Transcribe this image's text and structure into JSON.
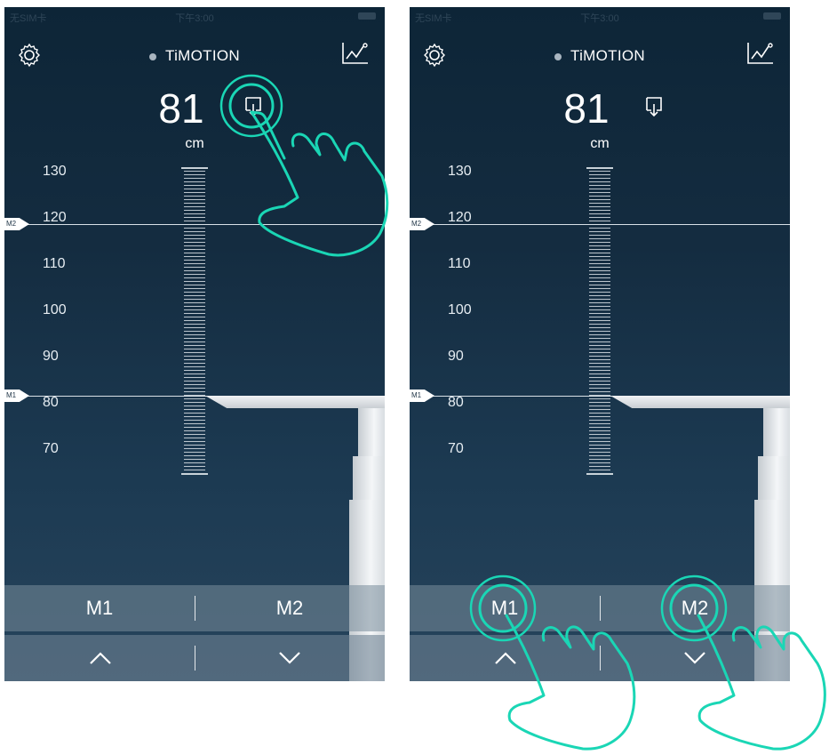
{
  "status": {
    "carrier": "无SIM卡",
    "time": "下午3:00"
  },
  "app": {
    "brand": "TiMOTION"
  },
  "height": {
    "value": "81",
    "unit": "cm"
  },
  "scale": {
    "labels": [
      "130",
      "120",
      "110",
      "100",
      "90",
      "80",
      "70"
    ]
  },
  "markers": {
    "m1": "M1",
    "m2": "M2"
  },
  "memory": {
    "m1_label": "M1",
    "m2_label": "M2"
  },
  "icons": {
    "settings": "gear-icon",
    "history": "line-chart-icon",
    "bluetooth": "bluetooth-icon",
    "save": "save-download-icon",
    "up": "chevron-up-icon",
    "down": "chevron-down-icon",
    "gesture": "tap-hand-icon"
  },
  "colors": {
    "accent": "#1ad6b5",
    "background_top": "#0d2537",
    "background_bottom": "#27445c"
  }
}
